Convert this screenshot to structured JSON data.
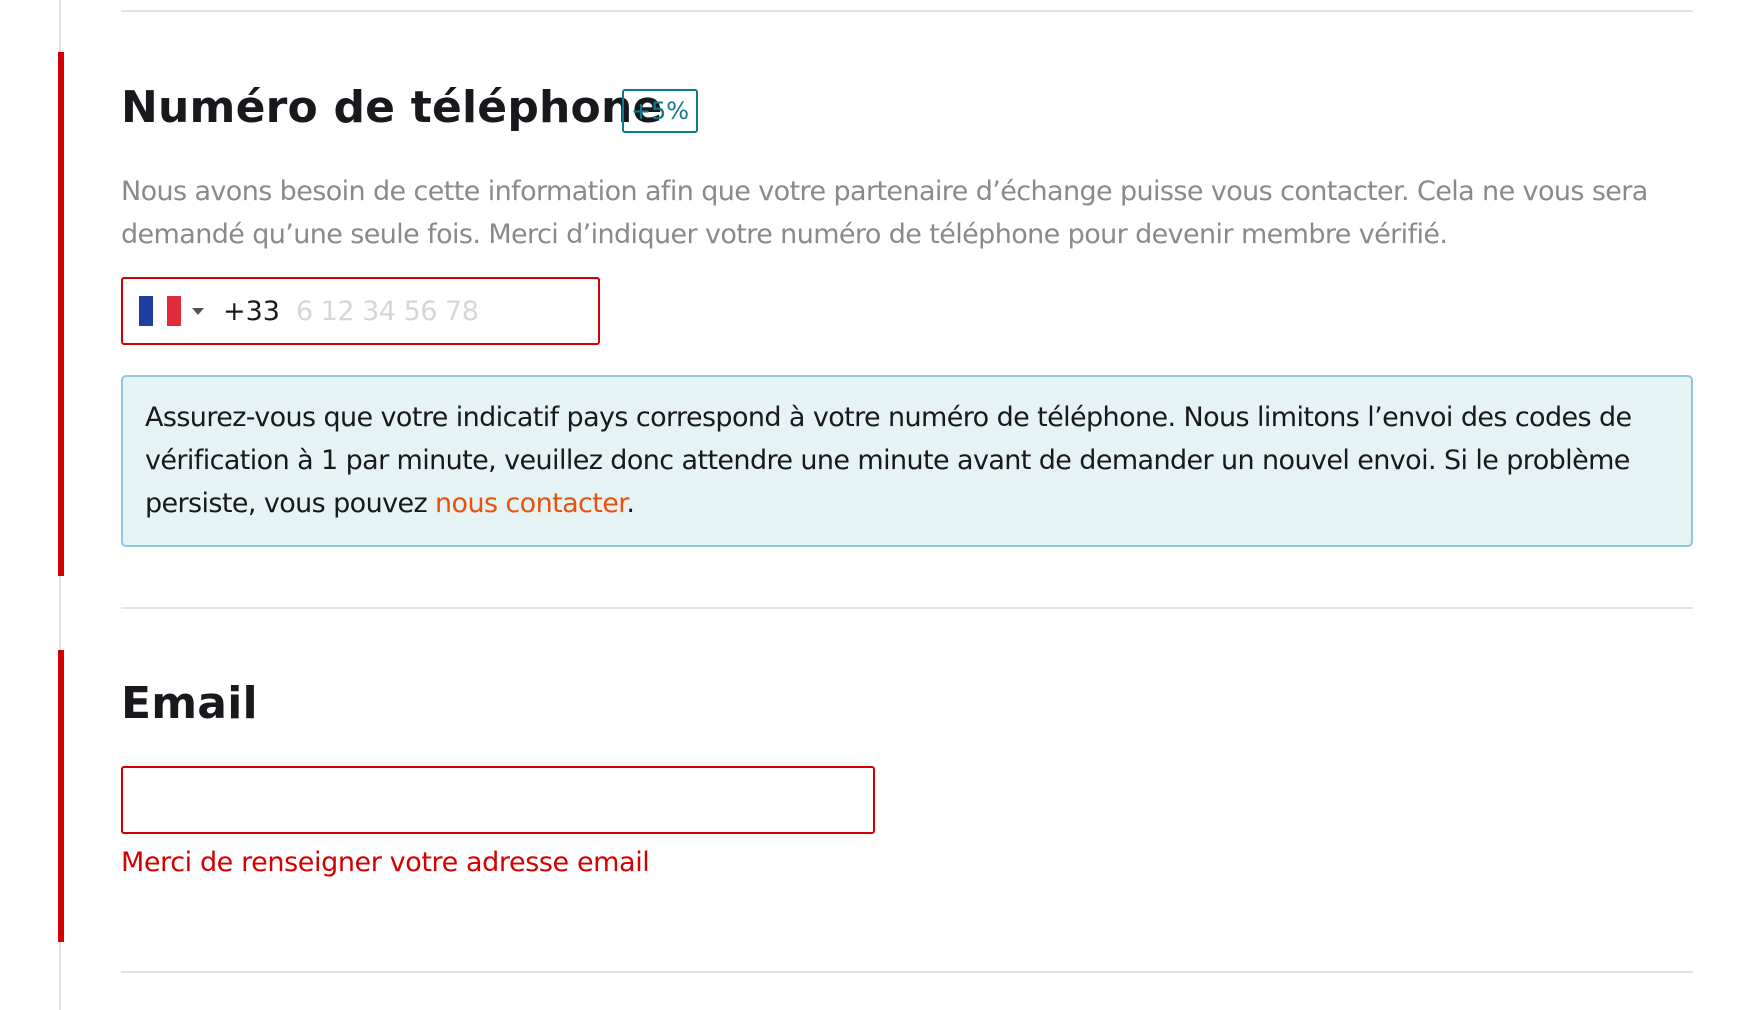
{
  "phone_section": {
    "title": "Numéro de téléphone",
    "badge": "+5%",
    "help_text": "Nous avons besoin de cette information afin que votre partenaire d’échange puisse vous contacter. Cela ne vous sera demandé qu’une seule fois. Merci d’indiquer votre numéro de téléphone pour devenir membre vérifié.",
    "country_flag": "france-flag-icon",
    "dial_code": "+33",
    "phone_value": "",
    "phone_placeholder": "6 12 34 56 78",
    "info_text": "Assurez-vous que votre indicatif pays correspond à votre numéro de téléphone. Nous limitons l’envoi des codes de vérification à 1 par minute, veuillez donc attendre une minute avant de demander un nouvel envoi. Si le problème persiste, vous pouvez ",
    "info_link": "nous contacter",
    "info_end": "."
  },
  "email_section": {
    "title": "Email",
    "email_value": "",
    "email_placeholder": "",
    "error_message": "Merci de renseigner votre adresse email"
  },
  "colors": {
    "error": "#d40000",
    "badge": "#137a8c",
    "link": "#e8530b",
    "info_background": "#e5f3f4",
    "info_border": "#8ccad8"
  }
}
